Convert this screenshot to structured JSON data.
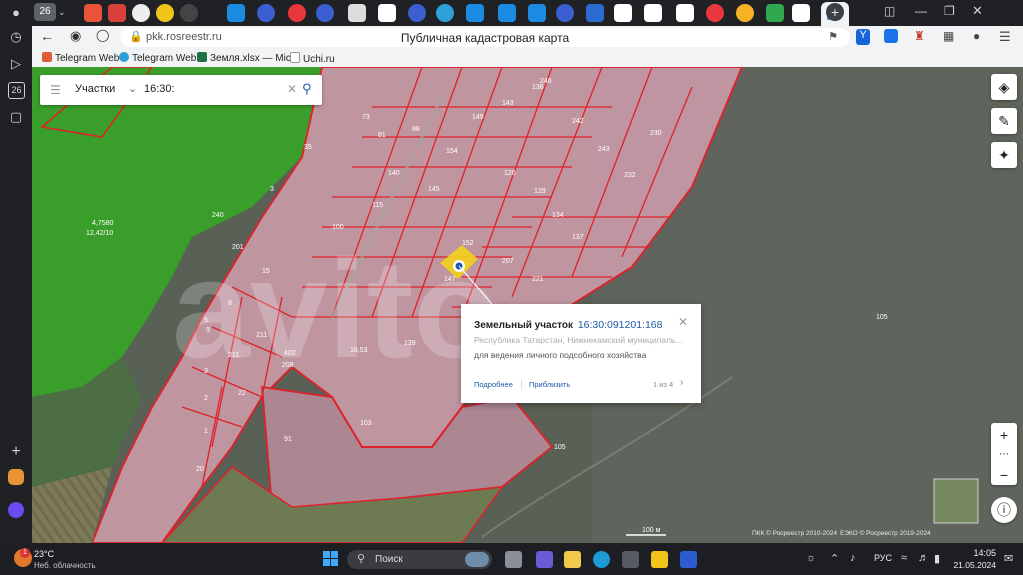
{
  "browser": {
    "tab_count": "26",
    "address_url": "pkk.rosreestr.ru",
    "page_title": "Публичная кадастровая карта"
  },
  "bookmarks": [
    {
      "label": "Telegram Web"
    },
    {
      "label": "Telegram Web"
    },
    {
      "label": "Земля.xlsx — Mic"
    },
    {
      "label": "Uchi.ru"
    }
  ],
  "search": {
    "category": "Участки",
    "query": "16:30:"
  },
  "map": {
    "parcel_labels": [
      "4,7580",
      "12,42/10",
      "3",
      "240",
      "201",
      "15",
      "8",
      "5",
      "3",
      "9",
      "2",
      "22",
      "1",
      "91",
      "20",
      "103",
      "139",
      "105",
      "105",
      "18,53",
      "211",
      "211",
      "402",
      "208",
      "35",
      "73",
      "81",
      "88",
      "154",
      "149",
      "143",
      "138",
      "115",
      "100",
      "140",
      "145",
      "126",
      "129",
      "134",
      "137",
      "246",
      "242",
      "243",
      "232",
      "230",
      "207",
      "221",
      "152",
      "147"
    ],
    "scale_label": "100 м",
    "attribution_left": "ПКК © Росреестр 2010-2024",
    "attribution_right": "ЕЭКО © Росреестр 2019-2024",
    "watermark": "avito"
  },
  "popup": {
    "type_label": "Земельный участок",
    "cadastral_number": "16:30:091201:168",
    "address": "Республика Татарстан, Нижнекамский муниципаль...",
    "usage": "для ведения личного подсобного хозяйства",
    "more_link": "Подробнее",
    "zoom_link": "Приблизить",
    "pager": "1 из 4"
  },
  "taskbar": {
    "weather_temp": "23°C",
    "weather_desc": "Неб. облачность",
    "weather_badge": "1",
    "search_placeholder": "Поиск",
    "lang": "РУС",
    "time": "14:05",
    "date": "21.05.2024"
  },
  "colors": {
    "parcel_border": "#e0212a",
    "parcel_fill": "#d9a7b4",
    "forest": "#3a9e2a",
    "highlight": "#f2d21c",
    "link": "#1d5ba8"
  }
}
